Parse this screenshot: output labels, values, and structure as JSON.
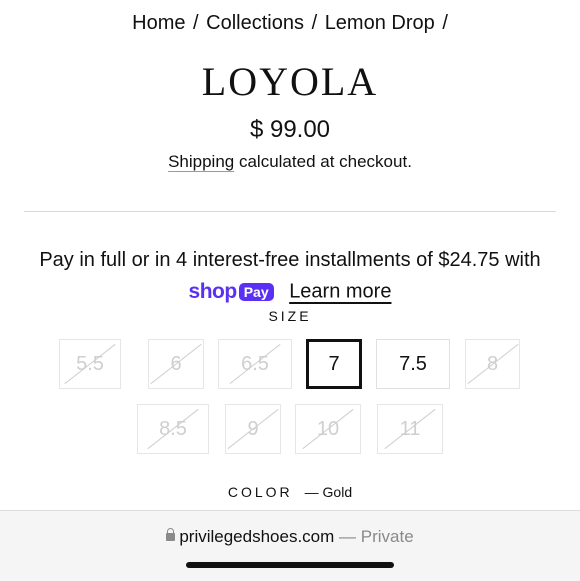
{
  "breadcrumb": {
    "home": "Home",
    "collections": "Collections",
    "lemon_drop": "Lemon Drop",
    "sep": "/"
  },
  "product": {
    "title": "LOYOLA",
    "price": "$ 99.00",
    "shipping_link": "Shipping",
    "shipping_rest": " calculated at checkout."
  },
  "installments": {
    "text": "Pay in full or in 4 interest-free installments of $24.75 with",
    "logo_shop": "shop",
    "logo_pay": "Pay",
    "learn_more": "Learn more"
  },
  "size": {
    "label": "SIZE",
    "options": [
      {
        "label": "5.5",
        "state": "disabled"
      },
      {
        "label": "6",
        "state": "disabled"
      },
      {
        "label": "6.5",
        "state": "disabled"
      },
      {
        "label": "7",
        "state": "selected"
      },
      {
        "label": "7.5",
        "state": "available"
      },
      {
        "label": "8",
        "state": "disabled"
      },
      {
        "label": "8.5",
        "state": "disabled"
      },
      {
        "label": "9",
        "state": "disabled"
      },
      {
        "label": "10",
        "state": "disabled"
      },
      {
        "label": "11",
        "state": "disabled"
      }
    ]
  },
  "color": {
    "label": "COLOR",
    "value": "— Gold"
  },
  "browser": {
    "domain": "privilegedshoes.com",
    "private": "— Private"
  },
  "colors": {
    "accent_shoppay": "#5a31f4",
    "disabled": "#cfcfcf",
    "selected_border": "#111111"
  },
  "icons": {
    "lock": "lock-icon",
    "strike": "diagonal-strike"
  }
}
